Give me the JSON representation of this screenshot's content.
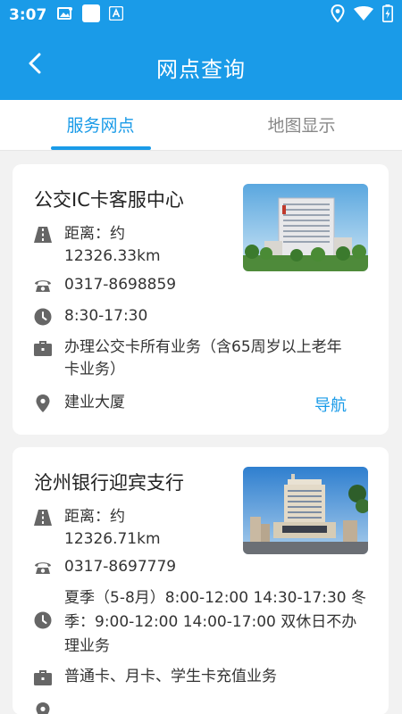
{
  "status": {
    "time": "3:07"
  },
  "header": {
    "title": "网点查询",
    "back_icon": "back-arrow-icon"
  },
  "tabs": [
    {
      "label": "服务网点",
      "active": true
    },
    {
      "label": "地图显示",
      "active": false
    }
  ],
  "colors": {
    "primary": "#1a9be8",
    "background": "#f2f2f2",
    "card": "#ffffff"
  },
  "outlets": [
    {
      "name": "公交IC卡客服中心",
      "distance_label": "距离：约",
      "distance_value": "12326.33km",
      "phone": "0317-8698859",
      "hours": "8:30-17:30",
      "business_line1": "办理公交卡所有业务（含65周岁以上老年",
      "business_line2": "卡业务）",
      "address": "建业大厦",
      "nav_label": "导航"
    },
    {
      "name": "沧州银行迎宾支行",
      "distance_label": "距离：约",
      "distance_value": "12326.71km",
      "phone": "0317-8697779",
      "hours_line1": "夏季（5-8月）8:00-12:00   14:30-17:30  冬",
      "hours_line2": "季：9:00-12:00   14:00-17:00  双休日不办",
      "hours_line3": "理业务",
      "business": "普通卡、月卡、学生卡充值业务"
    }
  ]
}
